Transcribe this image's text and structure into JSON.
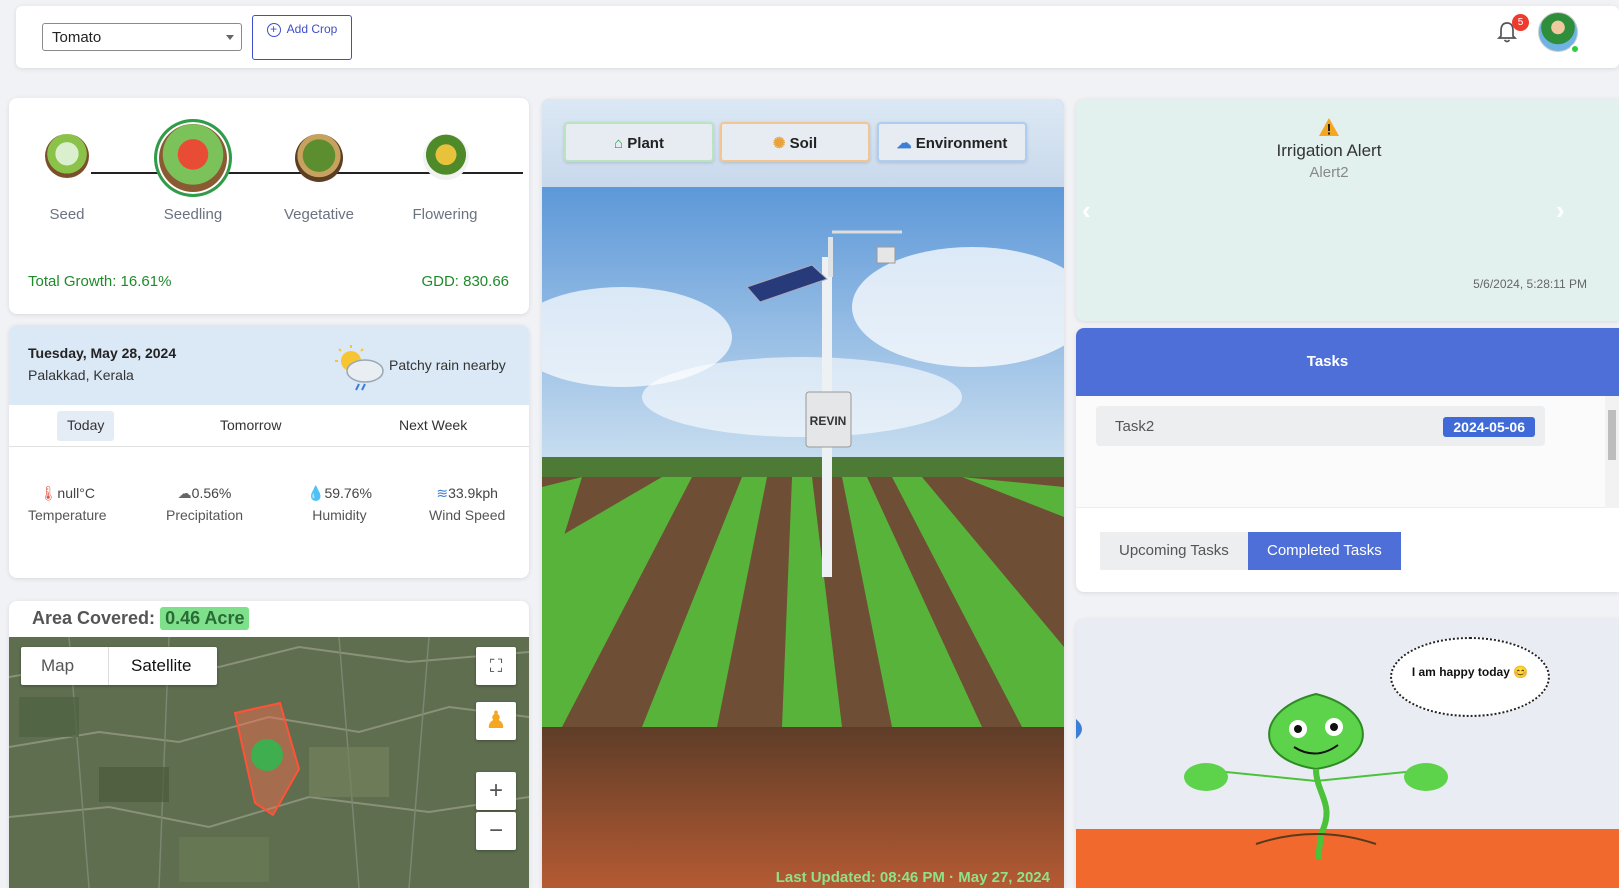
{
  "header": {
    "crop_selected": "Tomato",
    "add_crop_label": "Add Crop",
    "notification_count": "5"
  },
  "growth": {
    "stages": [
      {
        "label": "Seed"
      },
      {
        "label": "Seedling"
      },
      {
        "label": "Vegetative"
      },
      {
        "label": "Flowering"
      }
    ],
    "active_stage": "Seedling",
    "total_growth": "Total Growth: 16.61%",
    "gdd": "GDD: 830.66"
  },
  "weather": {
    "date": "Tuesday, May 28, 2024",
    "location": "Palakkad, Kerala",
    "condition": "Patchy rain nearby",
    "tabs": [
      "Today",
      "Tomorrow",
      "Next Week"
    ],
    "active_tab": "Today",
    "metrics": [
      {
        "value": "null°C",
        "name": "Temperature",
        "icon": "thermometer-icon"
      },
      {
        "value": "0.56%",
        "name": "Precipitation",
        "icon": "rain-cloud-icon"
      },
      {
        "value": "59.76%",
        "name": "Humidity",
        "icon": "humidity-icon"
      },
      {
        "value": "33.9kph",
        "name": "Wind Speed",
        "icon": "wind-icon"
      }
    ]
  },
  "map": {
    "area_label": "Area Covered:",
    "area_value": "0.46 Acre",
    "map_type_options": [
      "Map",
      "Satellite"
    ],
    "map_type_selected": "Satellite",
    "zoom_in": "+",
    "zoom_out": "−"
  },
  "center": {
    "tabs": [
      {
        "label": "Plant",
        "icon": "tree-icon",
        "color": "#2e9d4a"
      },
      {
        "label": "Soil",
        "icon": "sun-icon",
        "color": "#e8a33b"
      },
      {
        "label": "Environment",
        "icon": "cloud-icon",
        "color": "#3b7fd6"
      }
    ],
    "sensor_brand": "REVIN",
    "last_updated": "Last Updated: 08:46 PM · May 27, 2024"
  },
  "alert": {
    "title": "Irrigation Alert",
    "subtitle": "Alert2",
    "timestamp": "5/6/2024, 5:28:11 PM"
  },
  "tasks": {
    "header": "Tasks",
    "items": [
      {
        "name": "Task2",
        "date": "2024-05-06"
      }
    ],
    "tabs": [
      "Upcoming Tasks",
      "Completed Tasks"
    ],
    "active_tab": "Completed Tasks"
  },
  "mascot": {
    "speech": "I am happy today 😊"
  },
  "colors": {
    "primary": "#4f6fd8",
    "growth_green": "#1f8a2a",
    "badge_red": "#ef3b2d",
    "alert_bg": "#e3f1ee"
  }
}
